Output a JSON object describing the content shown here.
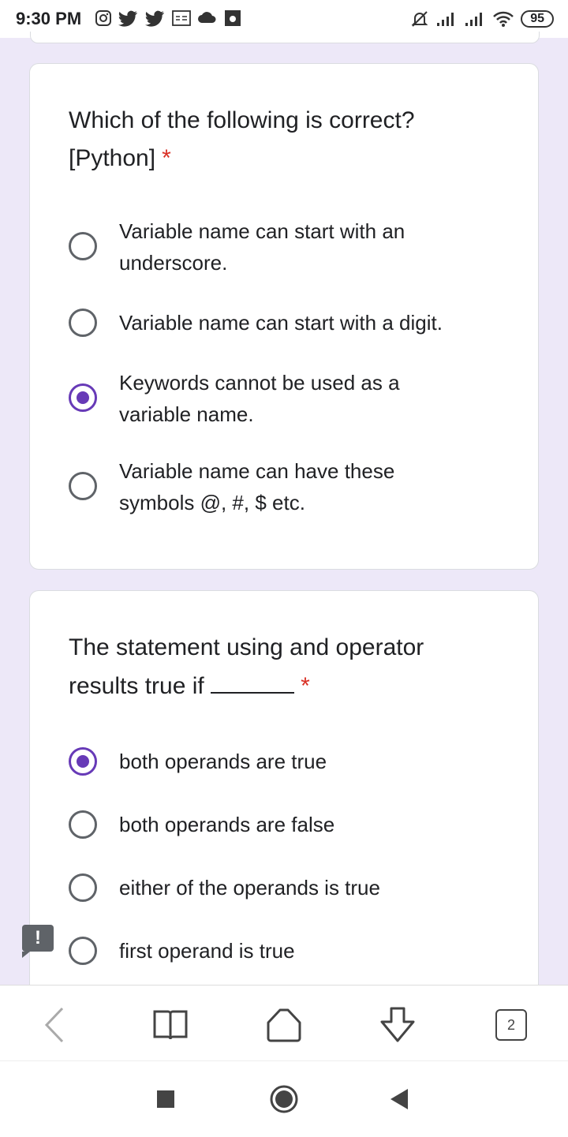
{
  "status_bar": {
    "time": "9:30 PM",
    "left_icons": [
      "instagram-icon",
      "twitter-icon",
      "twitter-icon",
      "news-icon",
      "cloud-icon",
      "app-icon"
    ],
    "right_icons": [
      "mute-icon",
      "signal-icon",
      "signal-icon",
      "wifi-icon"
    ],
    "battery": "95"
  },
  "questions": [
    {
      "title": "Which of the following is correct? [Python]",
      "required_mark": "*",
      "options": [
        {
          "label": "Variable name can start with an underscore.",
          "selected": false
        },
        {
          "label": "Variable name can start with a digit.",
          "selected": false
        },
        {
          "label": "Keywords cannot be used as a variable name.",
          "selected": true
        },
        {
          "label": "Variable name can have these symbols @, #, $ etc.",
          "selected": false
        }
      ]
    },
    {
      "title": "The statement using and operator results true if",
      "required_mark": "*",
      "options": [
        {
          "label": "both operands are true",
          "selected": true
        },
        {
          "label": "both operands are false",
          "selected": false
        },
        {
          "label": "either of the operands is true",
          "selected": false
        },
        {
          "label": "first operand is true",
          "selected": false
        }
      ]
    }
  ],
  "feedback_mark": "!",
  "browser_toolbar": {
    "tab_count": "2"
  },
  "colors": {
    "accent": "#673ab7",
    "required": "#d93025",
    "background": "#ede8f8"
  }
}
